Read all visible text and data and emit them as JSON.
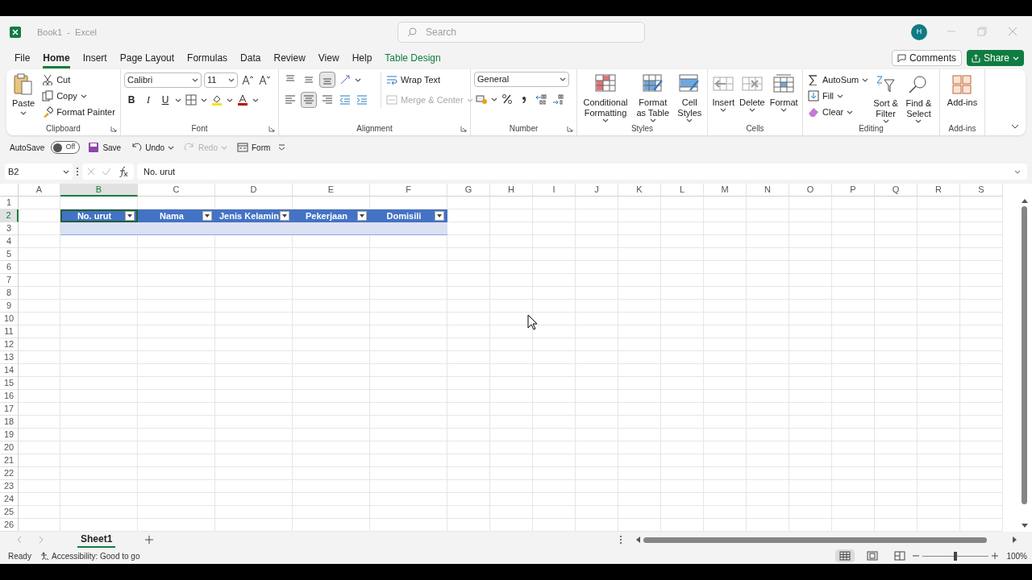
{
  "window": {
    "title": "Book1  -  Excel",
    "search": {
      "placeholder": "Search"
    },
    "avatar": "H"
  },
  "menu_tabs": [
    {
      "label": "File",
      "selected": false,
      "kind": "normal"
    },
    {
      "label": "Home",
      "selected": true,
      "kind": "normal"
    },
    {
      "label": "Insert",
      "selected": false,
      "kind": "normal"
    },
    {
      "label": "Page Layout",
      "selected": false,
      "kind": "normal"
    },
    {
      "label": "Formulas",
      "selected": false,
      "kind": "normal"
    },
    {
      "label": "Data",
      "selected": false,
      "kind": "normal"
    },
    {
      "label": "Review",
      "selected": false,
      "kind": "normal"
    },
    {
      "label": "View",
      "selected": false,
      "kind": "normal"
    },
    {
      "label": "Help",
      "selected": false,
      "kind": "normal"
    },
    {
      "label": "Table Design",
      "selected": false,
      "kind": "contextual"
    }
  ],
  "header_buttons": [
    {
      "label": "Comments",
      "kind": "outline"
    },
    {
      "label": "Share",
      "kind": "primary"
    }
  ],
  "ribbon": {
    "groups": [
      {
        "kind": "clipboard",
        "label": "Clipboard",
        "paste": "Paste",
        "items": [
          {
            "label": "Cut"
          },
          {
            "label": "Copy"
          },
          {
            "label": "Format Painter"
          }
        ]
      },
      {
        "kind": "font",
        "label": "Font",
        "font_name": "Calibri",
        "font_size": "11",
        "styles": [
          "B",
          "I",
          "U"
        ]
      },
      {
        "kind": "alignment",
        "label": "Alignment",
        "vertical": [
          {
            "selected": false
          },
          {
            "selected": false
          },
          {
            "selected": true
          }
        ],
        "horizontal": [
          {
            "selected": false
          },
          {
            "selected": true
          },
          {
            "selected": false
          }
        ],
        "items": [
          {
            "label": "Wrap Text",
            "disabled": false
          },
          {
            "label": "Merge & Center",
            "disabled": true
          }
        ]
      },
      {
        "kind": "number",
        "label": "Number",
        "format": "General"
      },
      {
        "kind": "large",
        "label": "Styles",
        "items": [
          {
            "label": "Conditional Formatting",
            "dropdown": true
          },
          {
            "label": "Format as Table",
            "dropdown": true
          },
          {
            "label": "Cell Styles",
            "dropdown": true
          }
        ]
      },
      {
        "kind": "large",
        "label": "Cells",
        "items": [
          {
            "label": "Insert",
            "dropdown": true
          },
          {
            "label": "Delete",
            "dropdown": true
          },
          {
            "label": "Format",
            "dropdown": true
          }
        ]
      },
      {
        "kind": "editing",
        "label": "Editing",
        "small": [
          {
            "label": "AutoSum"
          },
          {
            "label": "Fill"
          },
          {
            "label": "Clear"
          }
        ],
        "items": [
          {
            "label": "Sort & Filter",
            "dropdown": true
          },
          {
            "label": "Find & Select",
            "dropdown": true
          }
        ]
      },
      {
        "kind": "large",
        "label": "Add-ins",
        "items": [
          {
            "label": "Add-ins",
            "dropdown": false
          }
        ]
      }
    ]
  },
  "quick_access": {
    "autosave": {
      "label": "AutoSave",
      "state": "Off",
      "on": false
    },
    "items": [
      {
        "label": "Save",
        "disabled": false
      },
      {
        "label": "Undo",
        "disabled": false
      },
      {
        "label": "Redo",
        "disabled": true
      },
      {
        "label": "Form",
        "disabled": false
      }
    ]
  },
  "formula_bar": {
    "name_box": "B2",
    "formula": "No. urut"
  },
  "sheet": {
    "columns": [
      {
        "label": "A",
        "selected": false
      },
      {
        "label": "B",
        "selected": true
      },
      {
        "label": "C",
        "selected": false
      },
      {
        "label": "D",
        "selected": false
      },
      {
        "label": "E",
        "selected": false
      },
      {
        "label": "F",
        "selected": false
      },
      {
        "label": "G",
        "selected": false
      },
      {
        "label": "H",
        "selected": false
      },
      {
        "label": "I",
        "selected": false
      },
      {
        "label": "J",
        "selected": false
      },
      {
        "label": "K",
        "selected": false
      },
      {
        "label": "L",
        "selected": false
      },
      {
        "label": "M",
        "selected": false
      },
      {
        "label": "N",
        "selected": false
      },
      {
        "label": "O",
        "selected": false
      },
      {
        "label": "P",
        "selected": false
      },
      {
        "label": "Q",
        "selected": false
      },
      {
        "label": "R",
        "selected": false
      },
      {
        "label": "S",
        "selected": false
      }
    ],
    "rows": [
      {
        "label": "1",
        "selected": false
      },
      {
        "label": "2",
        "selected": true
      },
      {
        "label": "3",
        "selected": false
      },
      {
        "label": "4",
        "selected": false
      },
      {
        "label": "5",
        "selected": false
      },
      {
        "label": "6",
        "selected": false
      },
      {
        "label": "7",
        "selected": false
      },
      {
        "label": "8",
        "selected": false
      },
      {
        "label": "9",
        "selected": false
      },
      {
        "label": "10",
        "selected": false
      },
      {
        "label": "11",
        "selected": false
      },
      {
        "label": "12",
        "selected": false
      },
      {
        "label": "13",
        "selected": false
      },
      {
        "label": "14",
        "selected": false
      },
      {
        "label": "15",
        "selected": false
      },
      {
        "label": "16",
        "selected": false
      },
      {
        "label": "17",
        "selected": false
      },
      {
        "label": "18",
        "selected": false
      },
      {
        "label": "19",
        "selected": false
      },
      {
        "label": "20",
        "selected": false
      },
      {
        "label": "21",
        "selected": false
      },
      {
        "label": "22",
        "selected": false
      },
      {
        "label": "23",
        "selected": false
      },
      {
        "label": "24",
        "selected": false
      },
      {
        "label": "25",
        "selected": false
      },
      {
        "label": "26",
        "selected": false
      }
    ],
    "table": {
      "headers": [
        {
          "label": "No. urut",
          "selected": true
        },
        {
          "label": "Nama",
          "selected": false
        },
        {
          "label": "Jenis Kelamin",
          "selected": false
        },
        {
          "label": "Pekerjaan",
          "selected": false
        },
        {
          "label": "Domisili",
          "selected": false
        }
      ],
      "empty_row": true
    }
  },
  "sheet_tabs": [
    {
      "label": "Sheet1",
      "selected": true
    }
  ],
  "status_bar": {
    "mode": "Ready",
    "accessibility": "Accessibility: Good to go",
    "views": [
      {
        "kind": "normal",
        "selected": true
      },
      {
        "kind": "page_layout",
        "selected": false
      },
      {
        "kind": "page_break",
        "selected": false
      }
    ],
    "zoom": {
      "level": 0.5,
      "reading": "100%"
    }
  }
}
